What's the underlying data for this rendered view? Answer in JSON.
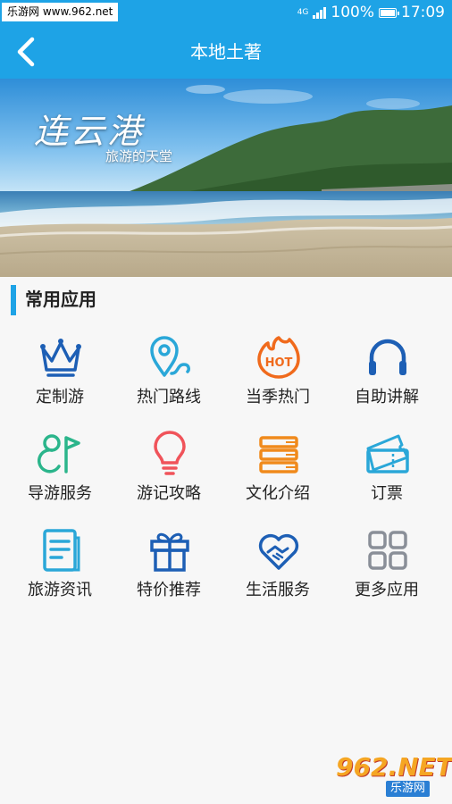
{
  "status_bar": {
    "watermark": "乐游网 www.962.net",
    "network": "4G",
    "battery": "100%",
    "time": "17:09"
  },
  "nav": {
    "title": "本地土著",
    "back_icon": "chevron-left-icon"
  },
  "banner": {
    "title": "连云港",
    "subtitle": "旅游的天堂"
  },
  "section": {
    "title": "常用应用",
    "accent_color": "#1ea3e6"
  },
  "apps": [
    {
      "label": "定制游",
      "icon": "crown-icon"
    },
    {
      "label": "热门路线",
      "icon": "location-route-icon"
    },
    {
      "label": "当季热门",
      "icon": "hot-flame-icon"
    },
    {
      "label": "自助讲解",
      "icon": "headphones-icon"
    },
    {
      "label": "导游服务",
      "icon": "guide-flag-icon"
    },
    {
      "label": "游记攻略",
      "icon": "lightbulb-icon"
    },
    {
      "label": "文化介绍",
      "icon": "books-icon"
    },
    {
      "label": "订票",
      "icon": "ticket-icon"
    },
    {
      "label": "旅游资讯",
      "icon": "document-icon"
    },
    {
      "label": "特价推荐",
      "icon": "gift-icon"
    },
    {
      "label": "生活服务",
      "icon": "handshake-heart-icon"
    },
    {
      "label": "更多应用",
      "icon": "grid-icon"
    }
  ],
  "watermark_logo": {
    "main": "962.NET",
    "sub": "乐游网"
  }
}
